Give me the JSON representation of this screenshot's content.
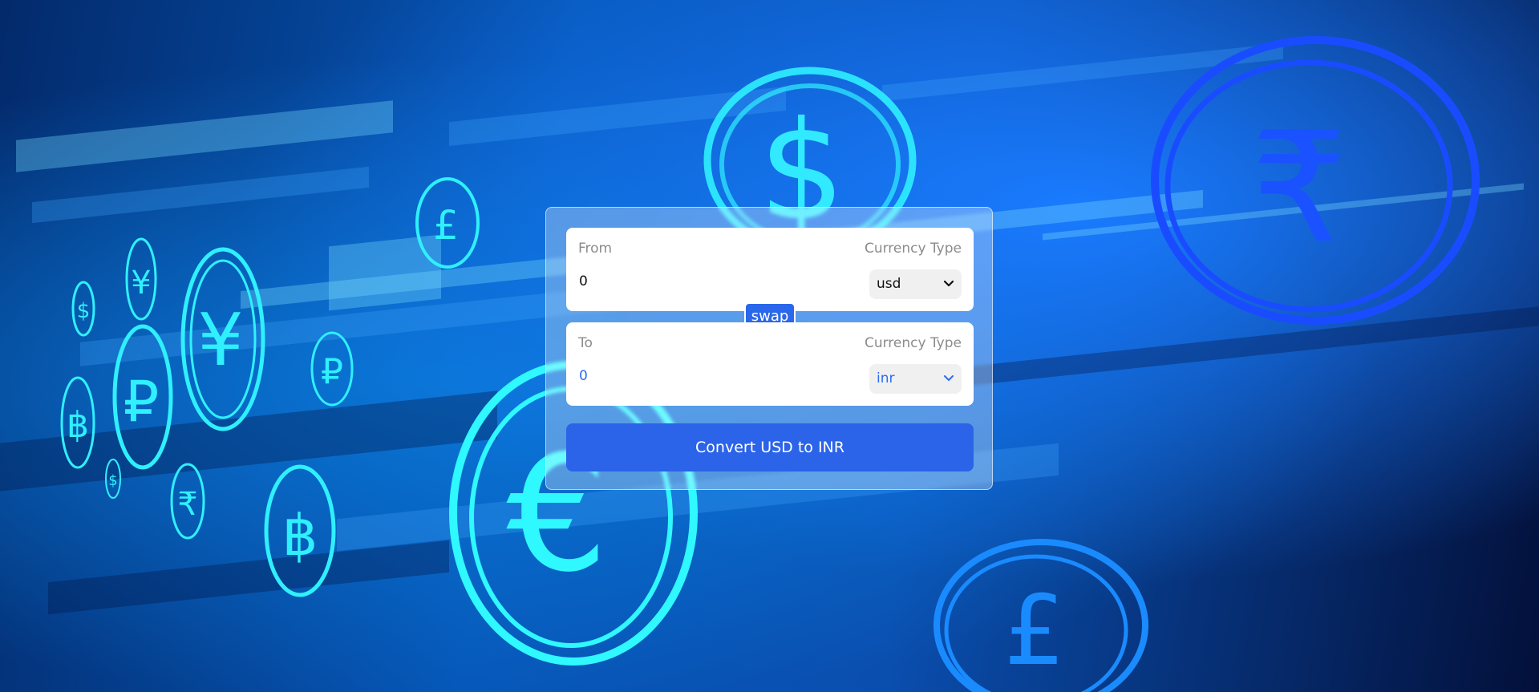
{
  "background": {
    "coin_symbols": [
      "$",
      "₹",
      "£",
      "€",
      "¥",
      "₽",
      "฿",
      "£",
      "$",
      "฿",
      "₽",
      "₹",
      "¥",
      "$",
      "£"
    ]
  },
  "converter": {
    "from": {
      "label": "From",
      "currency_type_label": "Currency Type",
      "amount": "0",
      "currency": "usd"
    },
    "swap_label": "swap",
    "to": {
      "label": "To",
      "currency_type_label": "Currency Type",
      "amount": "0",
      "currency": "inr"
    },
    "convert_label": "Convert USD to INR"
  },
  "colors": {
    "accent": "#2b63e9",
    "to_text": "#2b6cf5"
  }
}
